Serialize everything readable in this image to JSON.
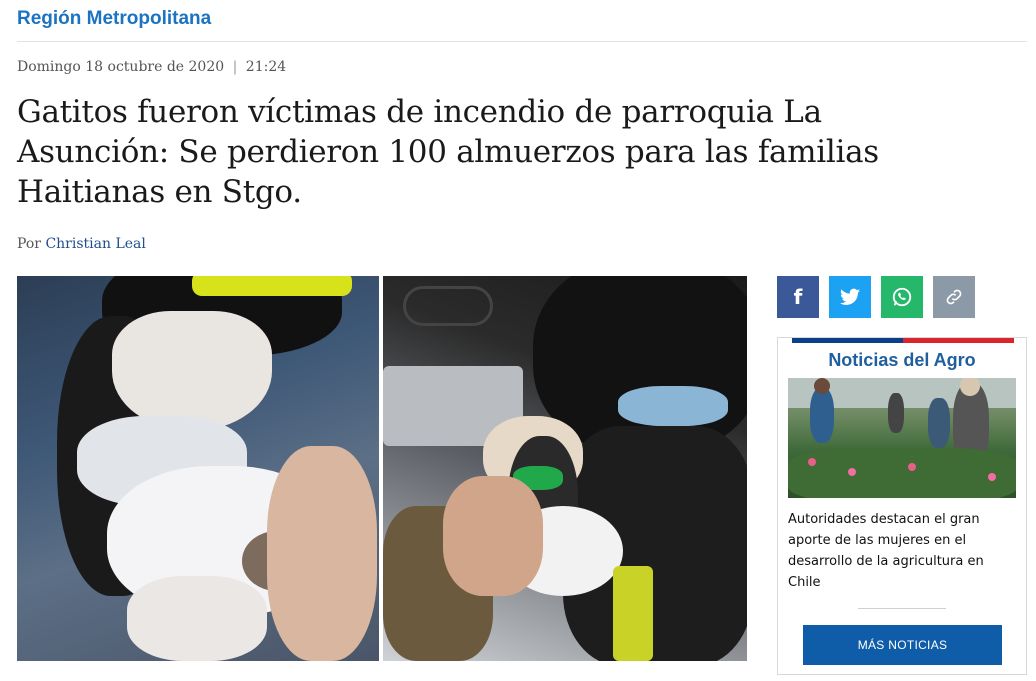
{
  "section": {
    "label": "Región Metropolitana"
  },
  "article": {
    "date": "Domingo 18 octubre de 2020",
    "separator": "|",
    "time": "21:24",
    "headline": "Gatitos fueron víctimas de incendio de parroquia La Asunción: Se perdieron 100 almuerzos para las familias Haitianas en Stgo.",
    "byline_prefix": "Por",
    "author": "Christian Leal"
  },
  "share": {
    "buttons": [
      {
        "icon": "facebook-icon",
        "glyph": "f",
        "color": "#3b5998"
      },
      {
        "icon": "twitter-icon",
        "glyph": "🐦",
        "color": "#1da1f2"
      },
      {
        "icon": "whatsapp-icon",
        "glyph": "✆",
        "color": "#25b86a"
      },
      {
        "icon": "link-icon",
        "glyph": "🔗",
        "color": "#8c9aa8"
      }
    ]
  },
  "sidebar": {
    "box_title": "Noticias del Agro",
    "stripe_colors": [
      "#0b3f8a",
      "#d9262c",
      "#ffffff"
    ],
    "caption": "Autoridades destacan el gran aporte de las mujeres en el desarrollo de la agricultura en Chile",
    "more_button": "MÁS NOTICIAS"
  }
}
